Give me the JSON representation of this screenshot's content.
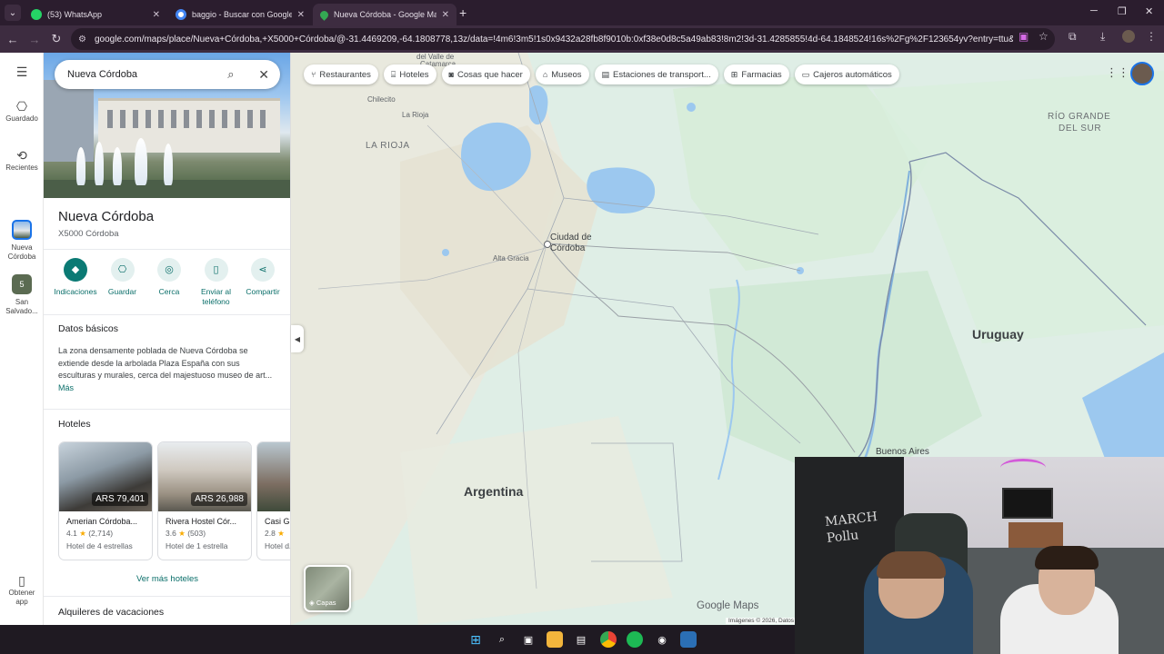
{
  "browser": {
    "tabs": [
      {
        "label": "(53) WhatsApp",
        "active": false,
        "favicon_color": "#25d366"
      },
      {
        "label": "baggio - Buscar con Google",
        "active": false,
        "favicon_color": "#4285f4"
      },
      {
        "label": "Nueva Córdoba - Google Maps",
        "active": true,
        "favicon_color": "#34a853"
      }
    ],
    "url": "google.com/maps/place/Nueva+Córdoba,+X5000+Córdoba/@-31.4469209,-64.1808778,13z/data=!4m6!3m5!1s0x9432a28fb8f9010b:0xf38e0d8c5a49ab83!8m2!3d-31.4285855!4d-64.1848524!16s%2Fg%2F123654yv?entry=ttu&g_ep=EgoyMDI..."
  },
  "rail": {
    "saved": "Guardado",
    "recent": "Recientes",
    "current_place": "Nueva Córdoba",
    "other_place": "San Salvado...",
    "other_place_badge": "5",
    "get_app": "Obtener app"
  },
  "search": {
    "query": "Nueva Córdoba"
  },
  "place": {
    "title": "Nueva Córdoba",
    "subtitle": "X5000 Córdoba",
    "actions": [
      {
        "label": "Indicaciones",
        "icon": "directions-icon"
      },
      {
        "label": "Guardar",
        "icon": "bookmark-icon"
      },
      {
        "label": "Cerca",
        "icon": "nearby-icon"
      },
      {
        "label": "Enviar al teléfono",
        "icon": "send-to-phone-icon"
      },
      {
        "label": "Compartir",
        "icon": "share-icon"
      }
    ],
    "basics_heading": "Datos básicos",
    "description": "La zona densamente poblada de Nueva Córdoba se extiende desde la arbolada Plaza España con sus esculturas y murales, cerca del majestuoso museo de art...",
    "more_link": "Más",
    "hotels_heading": "Hoteles",
    "hotels": [
      {
        "name": "Amerian Córdoba...",
        "rating": "4.1",
        "reviews": "(2,714)",
        "class": "Hotel de 4 estrellas",
        "price": "ARS 79,401"
      },
      {
        "name": "Rivera Hostel Cór...",
        "rating": "3.6",
        "reviews": "(503)",
        "class": "Hotel de 1 estrella",
        "price": "ARS 26,988"
      },
      {
        "name": "Casi G...",
        "rating": "2.8",
        "reviews": "",
        "class": "Hotel d...",
        "price": ""
      }
    ],
    "see_more_hotels": "Ver más hoteles",
    "rentals_heading": "Alquileres de vacaciones"
  },
  "chips": [
    {
      "label": "Restaurantes",
      "icon": "restaurant-icon"
    },
    {
      "label": "Hoteles",
      "icon": "hotel-icon"
    },
    {
      "label": "Cosas que hacer",
      "icon": "camera-icon"
    },
    {
      "label": "Museos",
      "icon": "museum-icon"
    },
    {
      "label": "Estaciones de transport...",
      "icon": "transit-icon"
    },
    {
      "label": "Farmacias",
      "icon": "pharmacy-icon"
    },
    {
      "label": "Cajeros automáticos",
      "icon": "atm-icon"
    }
  ],
  "map": {
    "labels": {
      "valle": "del Valle de",
      "catamarca": "Catamarca",
      "chilecito": "Chilecito",
      "la_rioja_city": "La Rioja",
      "la_rioja_region": "LA RIOJA",
      "rio_grande_1": "RÍO GRANDE",
      "rio_grande_2": "DEL SUR",
      "ciudad_cordoba_1": "Ciudad de",
      "ciudad_cordoba_2": "Córdoba",
      "alta_gracia": "Alta Gracia",
      "uruguay": "Uruguay",
      "argentina": "Argentina",
      "buenos_aires": "Buenos Aires"
    },
    "layers_label": "Capas",
    "logo": "Google Maps",
    "attribution": "Imágenes © 2026, Datos"
  },
  "webcam": {
    "board_text_1": "MARCH",
    "board_text_2": "Pollu"
  },
  "colors": {
    "accent": "#0b7a74",
    "map_land": "#dfeee6",
    "map_water": "#9cc8ef",
    "browser_frame": "#3d2c40"
  }
}
